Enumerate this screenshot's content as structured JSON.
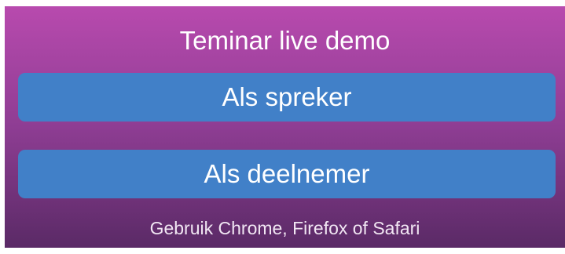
{
  "header": {
    "title": "Teminar live demo"
  },
  "buttons": {
    "speaker_label": "Als spreker",
    "participant_label": "Als deelnemer"
  },
  "footer": {
    "hint": "Gebruik Chrome, Firefox of Safari"
  },
  "colors": {
    "gradient_top": "#b84aae",
    "gradient_bottom": "#5a2a66",
    "button": "#4180c8",
    "text": "#ffffff"
  }
}
